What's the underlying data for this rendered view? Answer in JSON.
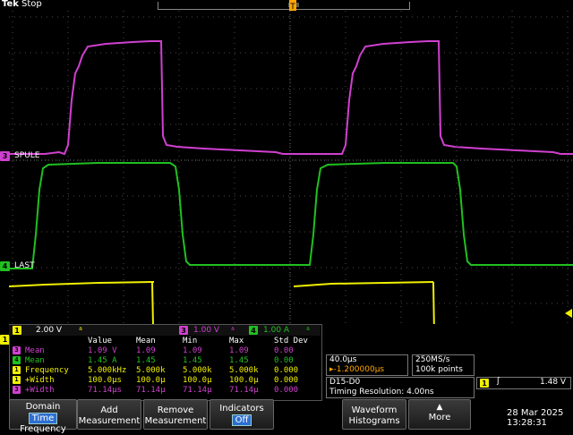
{
  "header": {
    "brand": "Tek",
    "run_state": "Stop"
  },
  "colors": {
    "ch1": "#f0f000",
    "ch3": "#d040d0",
    "ch4": "#20c020",
    "bus": "#ffa500",
    "grid": "#4a4a4a"
  },
  "markers": {
    "ch3_label": "SPULE",
    "ch4_label": "LAST",
    "ch3_num": "3",
    "ch4_num": "4",
    "ch1_num": "1",
    "trigger_t": "T"
  },
  "scale_bar": {
    "ch1_num": "1",
    "ch1_scale": "2.00 V",
    "ch1_bw": "ͣ",
    "ch3_num": "3",
    "ch3_scale": "1.00 V",
    "ch3_bw": "ͣ",
    "ch4_num": "4",
    "ch4_scale": "1.00 A",
    "ch4_bw": "ͣ"
  },
  "measurements": {
    "headers": [
      "Value",
      "Mean",
      "Min",
      "Max",
      "Std Dev"
    ],
    "rows": [
      {
        "src": "3",
        "name": "Mean",
        "value": "1.09 V",
        "mean": "1.09",
        "min": "1.09",
        "max": "1.09",
        "std": "0.00",
        "color": "#d040d0"
      },
      {
        "src": "4",
        "name": "Mean",
        "value": "1.45 A",
        "mean": "1.45",
        "min": "1.45",
        "max": "1.45",
        "std": "0.00",
        "color": "#20c020"
      },
      {
        "src": "1",
        "name": "Frequency",
        "value": "5.000kHz",
        "mean": "5.000k",
        "min": "5.000k",
        "max": "5.000k",
        "std": "0.000",
        "color": "#f0f000"
      },
      {
        "src": "1",
        "name": "+Width",
        "value": "100.0µs",
        "mean": "100.0µ",
        "min": "100.0µ",
        "max": "100.0µ",
        "std": "0.000",
        "color": "#f0f000"
      },
      {
        "src": "3",
        "name": "+Width",
        "value": "71.14µs",
        "mean": "71.14µ",
        "min": "71.14µ",
        "max": "71.14µ",
        "std": "0.000",
        "color": "#d040d0"
      }
    ]
  },
  "horizontal": {
    "scale": "40.0µs",
    "delay": "▸-1.200000µs"
  },
  "acquisition": {
    "rate": "250MS/s",
    "points": "100k points"
  },
  "bus": {
    "name": "D15-D0",
    "timing": "Timing Resolution: 4.00ns"
  },
  "trigger": {
    "source": "1",
    "slope": "ʃ",
    "level": "1.48 V"
  },
  "softkeys": {
    "domain_l1": "Domain",
    "domain_l2": "Time",
    "domain_l3": "Frequency",
    "add_l1": "Add",
    "add_l2": "Measurement",
    "remove_l1": "Remove",
    "remove_l2": "Measurement",
    "ind_l1": "Indicators",
    "ind_l2": "Off",
    "wf_l1": "Waveform",
    "wf_l2": "Histograms",
    "more": "More",
    "more_arrow": "▲"
  },
  "datetime": {
    "date": "28 Mar  2025",
    "time": "13:28:31"
  }
}
